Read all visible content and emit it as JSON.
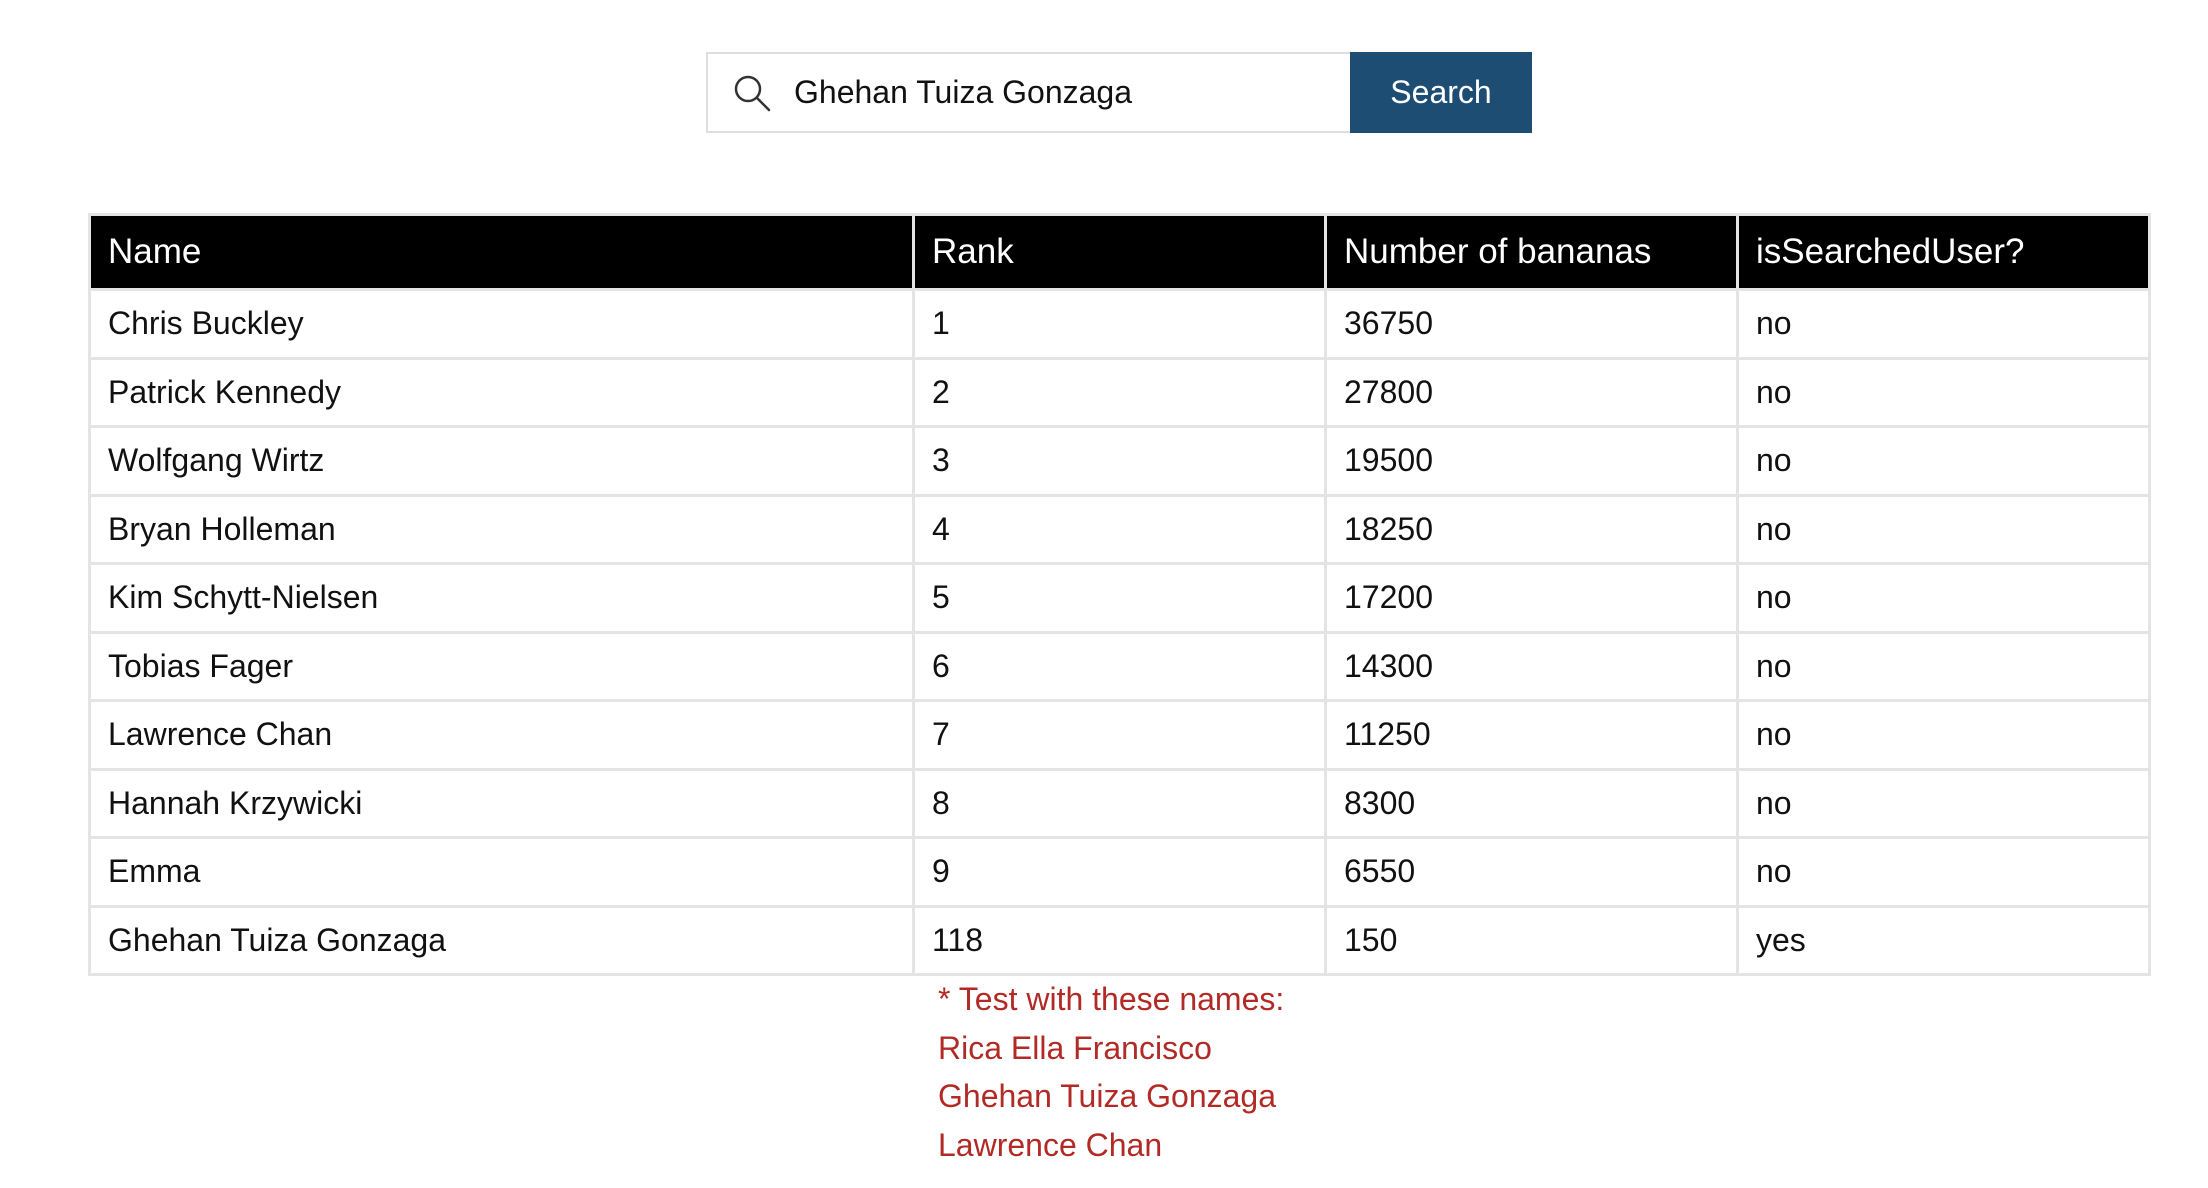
{
  "search": {
    "value": "Ghehan Tuiza Gonzaga",
    "button_label": "Search",
    "icon": "search-icon"
  },
  "table": {
    "headers": [
      "Name",
      "Rank",
      "Number of bananas",
      "isSearchedUser?"
    ],
    "rows": [
      [
        "Chris Buckley",
        "1",
        "36750",
        "no"
      ],
      [
        "Patrick Kennedy",
        "2",
        "27800",
        "no"
      ],
      [
        "Wolfgang Wirtz",
        "3",
        "19500",
        "no"
      ],
      [
        "Bryan Holleman",
        "4",
        "18250",
        "no"
      ],
      [
        "Kim Schytt-Nielsen",
        "5",
        "17200",
        "no"
      ],
      [
        "Tobias Fager",
        "6",
        "14300",
        "no"
      ],
      [
        "Lawrence Chan",
        "7",
        "11250",
        "no"
      ],
      [
        "Hannah Krzywicki",
        "8",
        "8300",
        "no"
      ],
      [
        "Emma",
        "9",
        "6550",
        "no"
      ],
      [
        "Ghehan Tuiza Gonzaga",
        "118",
        "150",
        "yes"
      ]
    ]
  },
  "note": {
    "heading": "* Test with these names:",
    "names": [
      "Rica Ella Francisco",
      "Ghehan Tuiza Gonzaga",
      "Lawrence Chan"
    ]
  },
  "colors": {
    "button_bg": "#1e4d74",
    "header_bg": "#000000",
    "note_text": "#b22a25",
    "border": "#e4e4e4"
  }
}
